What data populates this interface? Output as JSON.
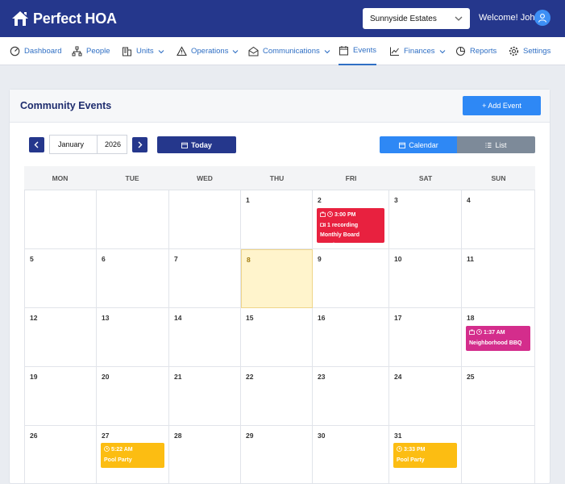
{
  "app": {
    "logo_text": "Perfect HOA"
  },
  "header": {
    "community": "Sunnyside Estates",
    "welcome": "Welcome! John"
  },
  "nav": {
    "items": [
      {
        "label": "Dashboard"
      },
      {
        "label": "People"
      },
      {
        "label": "Units"
      },
      {
        "label": "Operations"
      },
      {
        "label": "Communications"
      },
      {
        "label": "Events"
      },
      {
        "label": "Finances"
      },
      {
        "label": "Reports"
      },
      {
        "label": "Settings"
      }
    ]
  },
  "page": {
    "title": "Community Events",
    "add_label": "+ Add Event",
    "month": "January",
    "year": "2026",
    "today_label": "Today",
    "view_calendar": "Calendar",
    "view_list": "List"
  },
  "calendar": {
    "weekdays": [
      "MON",
      "TUE",
      "WED",
      "THU",
      "FRI",
      "SAT",
      "SUN"
    ],
    "days": [
      "1",
      "2",
      "3",
      "4",
      "5",
      "6",
      "7",
      "8",
      "9",
      "10",
      "11",
      "12",
      "13",
      "14",
      "15",
      "16",
      "17",
      "18",
      "19",
      "20",
      "21",
      "22",
      "23",
      "24",
      "25",
      "26",
      "27",
      "28",
      "29",
      "30",
      "31"
    ],
    "events": [
      {
        "time": "3:00 PM",
        "recording": "1 recording",
        "title": "Monthly Board Meeting"
      },
      {
        "time": "1:37 AM",
        "title": "Neighborhood BBQ"
      },
      {
        "time": "5:22 AM",
        "title": "Pool Party"
      },
      {
        "time": "3:33 PM",
        "title": "Pool Party"
      }
    ]
  },
  "colors": {
    "brand": "#25378c",
    "accent": "#2e88f5",
    "board": "#e8213f",
    "bbq": "#d42d8c",
    "pool": "#fcbd12"
  }
}
